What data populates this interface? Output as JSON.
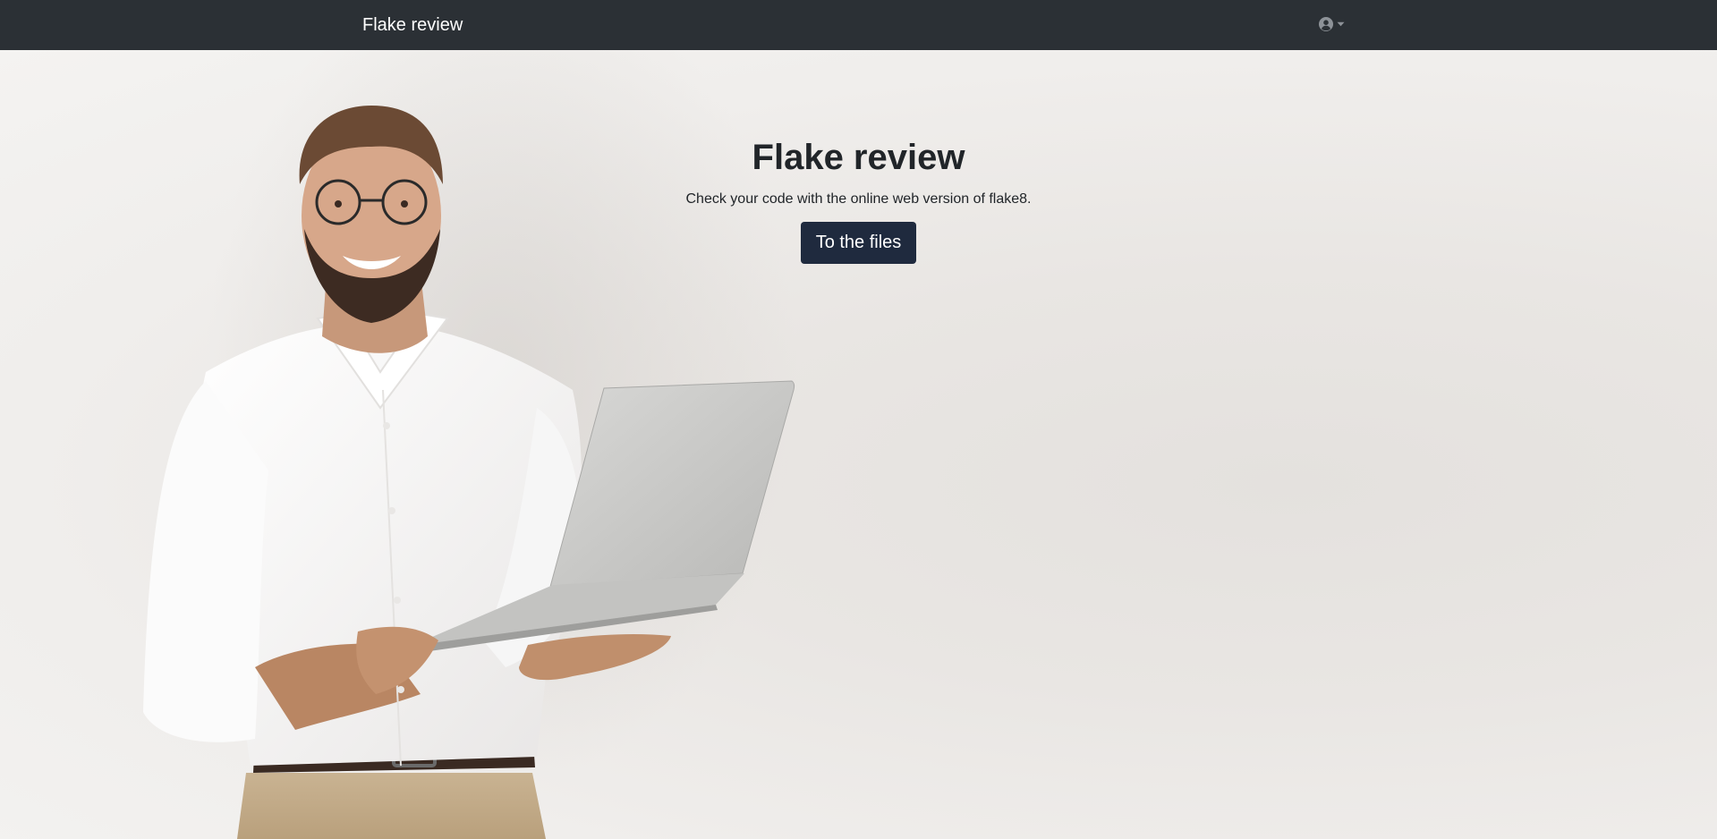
{
  "navbar": {
    "brand": "Flake review",
    "user_icon": "user-circle-icon",
    "dropdown_icon": "caret-down-icon"
  },
  "hero": {
    "title": "Flake review",
    "lead": "Check your code with the online web version of flake8.",
    "cta_label": "To the files",
    "image": "man-holding-laptop-photo"
  },
  "colors": {
    "navbar_bg": "#2b3035",
    "cta_bg": "#1f2a3e",
    "text": "#212529"
  }
}
